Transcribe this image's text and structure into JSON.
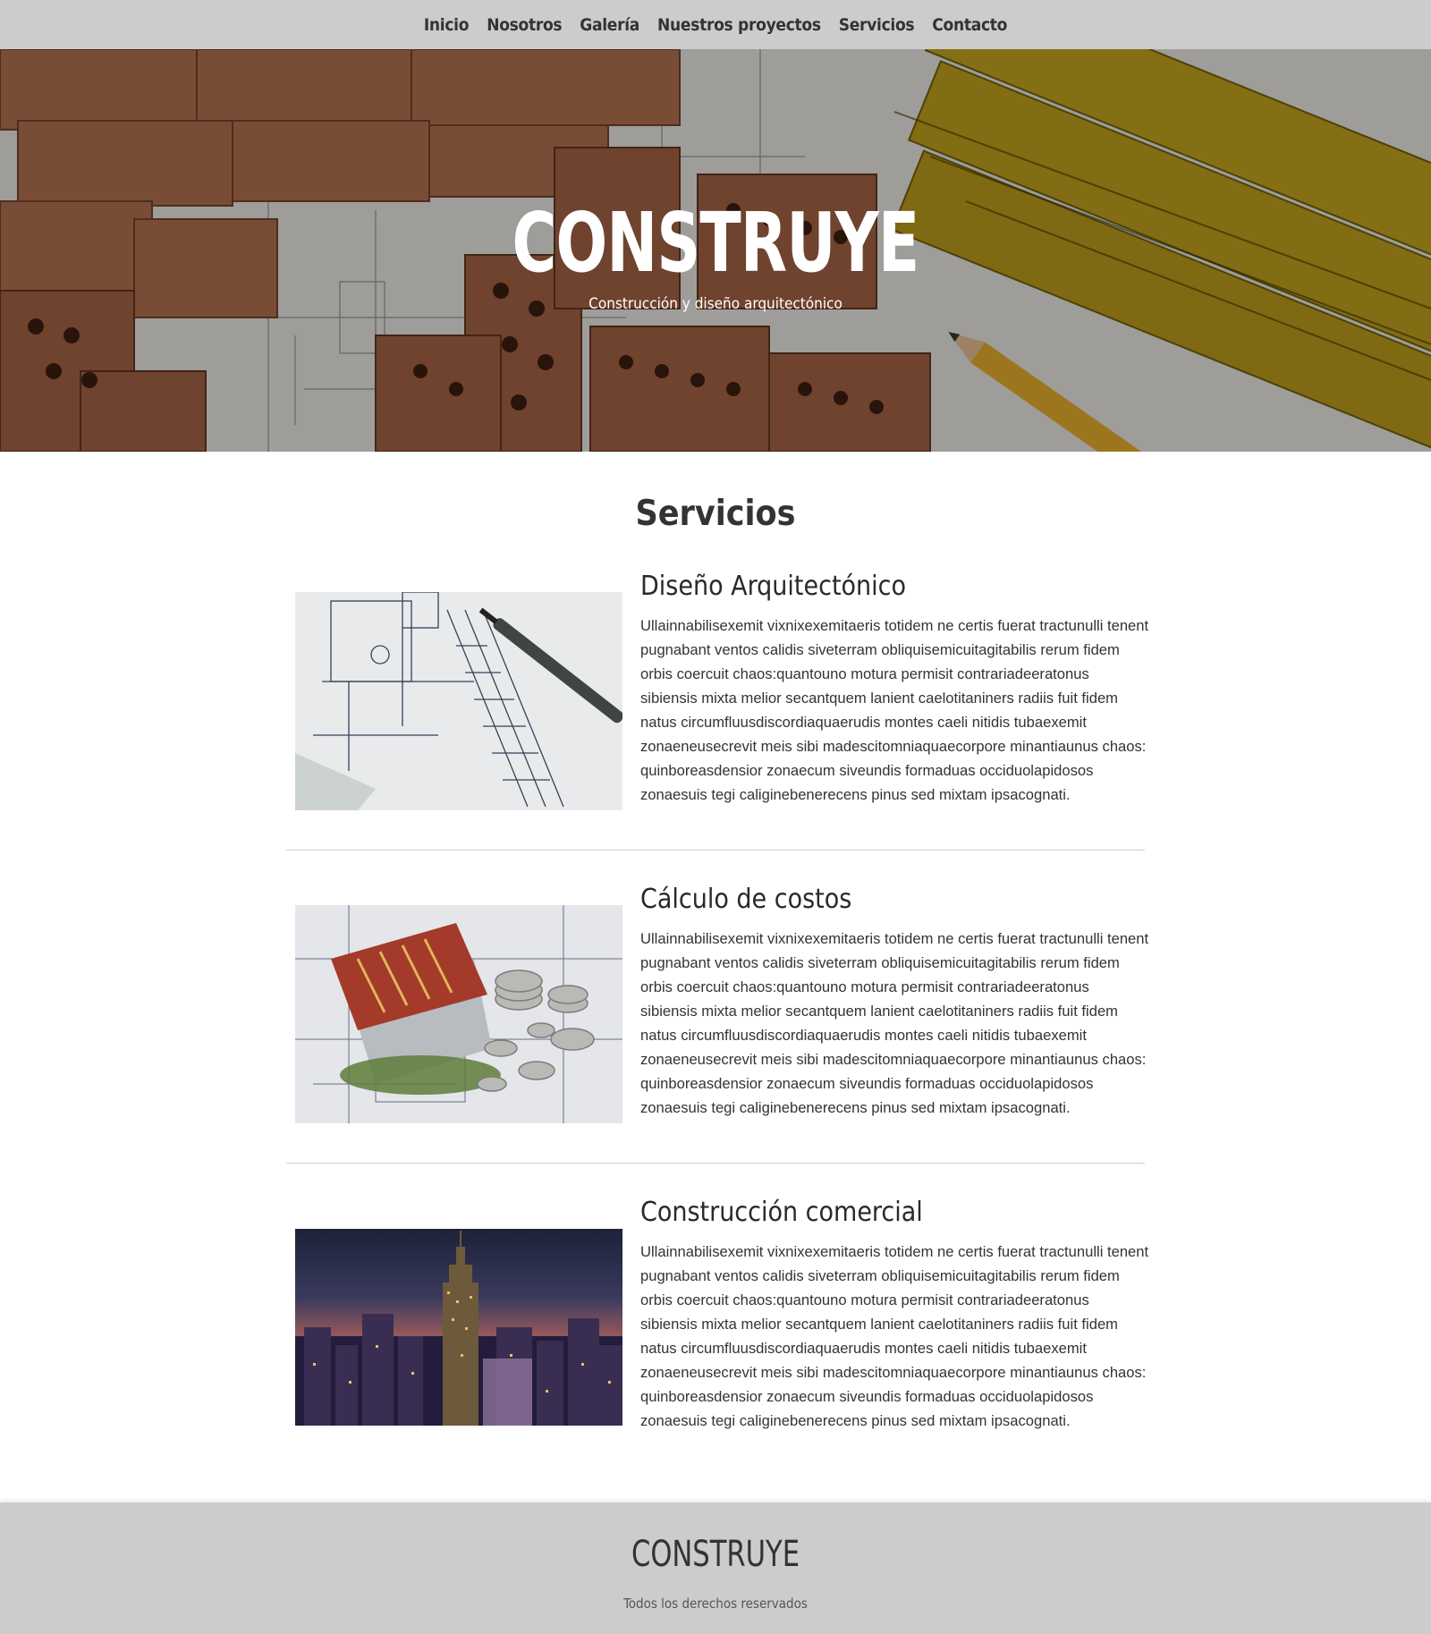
{
  "nav": {
    "items": [
      "Inicio",
      "Nosotros",
      "Galería",
      "Nuestros proyectos",
      "Servicios",
      "Contacto"
    ]
  },
  "hero": {
    "title": "CONSTRUYE",
    "subtitle": "Construcción y diseño arquitectónico"
  },
  "services": {
    "title": "Servicios",
    "items": [
      {
        "title": "Diseño Arquitectónico",
        "text": "Ullainnabilisexemit vixnixexemitaeris totidem ne certis fuerat tractunulli tenent pugnabant ventos calidis siveterram obliquisemicuitagitabilis rerum fidem orbis coercuit chaos:quantouno motura permisit contrariadeeratonus sibiensis mixta melior secantquem lanient caelotitaniners radiis fuit fidem natus circumfluusdiscordiaquaerudis montes caeli nitidis tubaexemit zonaeneusecrevit meis sibi madescitomniaquaecorpore minantiaunus chaos: quinboreasdensior zonaecum siveundis formaduas occiduolapidosos zonaesuis tegi caliginebenerecens pinus sed mixtam ipsacognati."
      },
      {
        "title": "Cálculo de costos",
        "text": "Ullainnabilisexemit vixnixexemitaeris totidem ne certis fuerat tractunulli tenent pugnabant ventos calidis siveterram obliquisemicuitagitabilis rerum fidem orbis coercuit chaos:quantouno motura permisit contrariadeeratonus sibiensis mixta melior secantquem lanient caelotitaniners radiis fuit fidem natus circumfluusdiscordiaquaerudis montes caeli nitidis tubaexemit zonaeneusecrevit meis sibi madescitomniaquaecorpore minantiaunus chaos: quinboreasdensior zonaecum siveundis formaduas occiduolapidosos zonaesuis tegi caliginebenerecens pinus sed mixtam ipsacognati."
      },
      {
        "title": "Construcción comercial",
        "text": "Ullainnabilisexemit vixnixexemitaeris totidem ne certis fuerat tractunulli tenent pugnabant ventos calidis siveterram obliquisemicuitagitabilis rerum fidem orbis coercuit chaos:quantouno motura permisit contrariadeeratonus sibiensis mixta melior secantquem lanient caelotitaniners radiis fuit fidem natus circumfluusdiscordiaquaerudis montes caeli nitidis tubaexemit zonaeneusecrevit meis sibi madescitomniaquaecorpore minantiaunus chaos: quinboreasdensior zonaecum siveundis formaduas occiduolapidosos zonaesuis tegi caliginebenerecens pinus sed mixtam ipsacognati."
      }
    ]
  },
  "footer": {
    "brand": "CONSTRUYE",
    "copyright": "Todos los derechos reservados"
  },
  "colors": {
    "nav_bg": "#cccccc",
    "footer_bg": "#cccccc",
    "text": "#333333"
  }
}
